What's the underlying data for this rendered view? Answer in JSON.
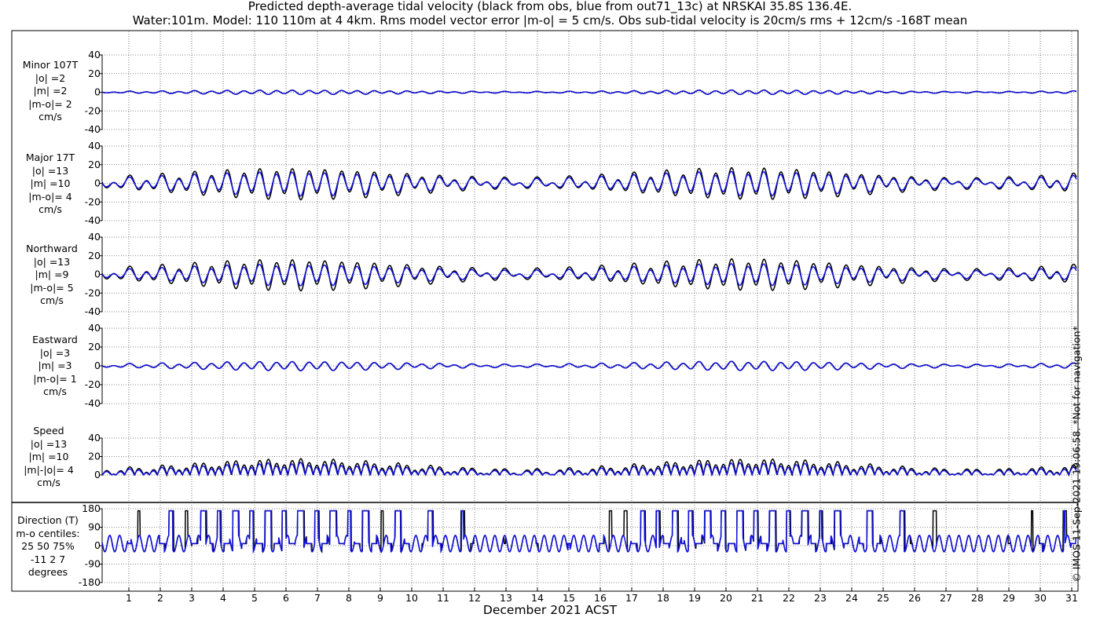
{
  "title": {
    "line1": "Predicted depth-average tidal velocity (black from obs, blue from out71_13c) at NRSKAI 35.8S 136.4E.",
    "line2": "Water:101m. Model: 110 110m at 4 4km. Rms model vector error |m-o| = 5 cm/s. Obs sub-tidal velocity is 20cm/s rms + 12cm/s -168T mean"
  },
  "xlabel": "December 2021 ACST",
  "credit": "© IMOS 11-Sep-2021 19:06:58. *Not for navigation*",
  "colors": {
    "obs": "#000000",
    "model": "#1010e0"
  },
  "panels": [
    {
      "id": "minor",
      "labels": [
        "Minor 107T",
        "|o| =2",
        "|m| =2",
        "|m-o|= 2",
        "cm/s"
      ]
    },
    {
      "id": "major",
      "labels": [
        "Major 17T",
        "|o| =13",
        "|m| =10",
        "|m-o|= 4",
        "cm/s"
      ]
    },
    {
      "id": "north",
      "labels": [
        "Northward",
        "|o| =13",
        "|m| =9",
        "|m-o|= 5",
        "cm/s"
      ]
    },
    {
      "id": "east",
      "labels": [
        "Eastward",
        "|o| =3",
        "|m| =3",
        "|m-o|= 1",
        "cm/s"
      ]
    },
    {
      "id": "speed",
      "labels": [
        "Speed",
        "|o| =13",
        "|m| =10",
        "|m|-|o|= 4",
        "cm/s"
      ]
    },
    {
      "id": "dir",
      "labels": [
        "Direction (T)",
        "m-o centiles:",
        "25  50  75%",
        "-11   2   7",
        "degrees"
      ]
    }
  ],
  "chart_data": [
    {
      "type": "line",
      "name": "minor",
      "series": [
        {
          "name": "obs",
          "amplitude": 2
        },
        {
          "name": "model",
          "amplitude": 2
        }
      ],
      "ylim": [
        -40,
        40
      ],
      "yticks": [
        -40,
        -20,
        0,
        20,
        40
      ],
      "ytick_labels": [
        "-40",
        "-20",
        "0",
        "20",
        "40"
      ]
    },
    {
      "type": "line",
      "name": "major",
      "series": [
        {
          "name": "obs",
          "amplitude": 13
        },
        {
          "name": "model",
          "amplitude": 10
        }
      ],
      "ylim": [
        -40,
        40
      ],
      "yticks": [
        -40,
        -20,
        0,
        20,
        40
      ],
      "ytick_labels": [
        "-40",
        "-20",
        "0",
        "20",
        "40"
      ]
    },
    {
      "type": "line",
      "name": "north",
      "series": [
        {
          "name": "obs",
          "amplitude": 13
        },
        {
          "name": "model",
          "amplitude": 9
        }
      ],
      "ylim": [
        -40,
        40
      ],
      "yticks": [
        -40,
        -20,
        0,
        20,
        40
      ],
      "ytick_labels": [
        "-40",
        "-20",
        "0",
        "20",
        "40"
      ]
    },
    {
      "type": "line",
      "name": "east",
      "series": [
        {
          "name": "obs",
          "amplitude": 3
        },
        {
          "name": "model",
          "amplitude": 3
        }
      ],
      "ylim": [
        -40,
        40
      ],
      "yticks": [
        -40,
        -20,
        0,
        20,
        40
      ],
      "ytick_labels": [
        "-40",
        "-20",
        "0",
        "20",
        "40"
      ]
    },
    {
      "type": "line",
      "name": "speed",
      "series": [
        {
          "name": "obs",
          "amplitude": 13
        },
        {
          "name": "model",
          "amplitude": 10
        }
      ],
      "ylim": [
        0,
        40
      ],
      "yticks": [
        0,
        20,
        40
      ],
      "ytick_labels": [
        "0",
        "20",
        "40"
      ]
    },
    {
      "type": "line",
      "name": "direction",
      "series": [
        {
          "name": "obs"
        },
        {
          "name": "model"
        }
      ],
      "ylim": [
        -180,
        180
      ],
      "yticks": [
        -180,
        -90,
        0,
        90,
        180
      ],
      "ytick_labels": [
        "-180",
        "-90",
        "0",
        "90",
        "180"
      ]
    }
  ],
  "x_axis": {
    "range_days": [
      0.15,
      31.15
    ],
    "ticks": [
      1,
      2,
      3,
      4,
      5,
      6,
      7,
      8,
      9,
      10,
      11,
      12,
      13,
      14,
      15,
      16,
      17,
      18,
      19,
      20,
      21,
      22,
      23,
      24,
      25,
      26,
      27,
      28,
      29,
      30,
      31
    ],
    "tick_labels": [
      "1",
      "2",
      "3",
      "4",
      "5",
      "6",
      "7",
      "8",
      "9",
      "10",
      "11",
      "12",
      "13",
      "14",
      "15",
      "16",
      "17",
      "18",
      "19",
      "20",
      "21",
      "22",
      "23",
      "24",
      "25",
      "26",
      "27",
      "28",
      "29",
      "30",
      "31"
    ]
  }
}
